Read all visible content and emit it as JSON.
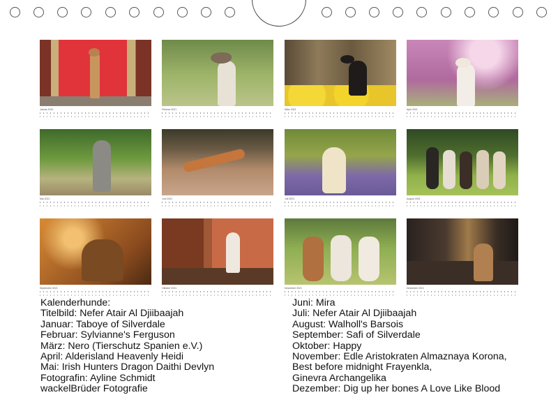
{
  "months": [
    {
      "label": "Januar 2021",
      "key": "jan"
    },
    {
      "label": "Februar 2021",
      "key": "feb"
    },
    {
      "label": "März 2021",
      "key": "mar"
    },
    {
      "label": "April 2021",
      "key": "apr"
    },
    {
      "label": "Mai 2021",
      "key": "may"
    },
    {
      "label": "Juni 2021",
      "key": "jun"
    },
    {
      "label": "Juli 2021",
      "key": "jul"
    },
    {
      "label": "August 2021",
      "key": "aug"
    },
    {
      "label": "September 2021",
      "key": "sep"
    },
    {
      "label": "Oktober 2021",
      "key": "oct"
    },
    {
      "label": "November 2021",
      "key": "nov"
    },
    {
      "label": "Dezember 2021",
      "key": "dec"
    }
  ],
  "credits_left": [
    "Kalenderhunde:",
    "Titelbild: Nefer Atair Al Djiibaajah",
    "Januar: Taboye of Silverdale",
    "Februar: Sylvianne's Ferguson",
    "März: Nero (Tierschutz Spanien e.V.)",
    "April: Alderisland Heavenly Heidi",
    "Mai: Irish Hunters Dragon Daithi Devlyn",
    "Fotografin: Ayline Schmidt",
    "wackelBrüder Fotografie"
  ],
  "credits_right": [
    "Juni: Mira",
    "Juli: Nefer Atair Al Djiibaajah",
    "August: Walholl's Barsois",
    "September: Safi of Silverdale",
    "Oktober: Happy",
    "November: Edle Aristokraten Almaznaya Korona,",
    "Best before midnight Frayenkla,",
    "Ginevra Archangelika",
    "Dezember: Dig up her bones A Love Like Blood"
  ]
}
